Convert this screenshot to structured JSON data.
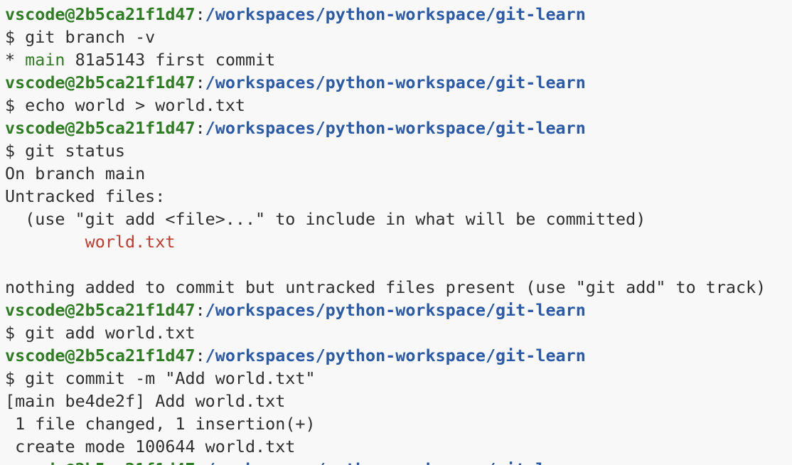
{
  "colors": {
    "background": "#f8f8f8",
    "text": "#2f2f2f",
    "prompt_user": "#2f7d22",
    "prompt_path": "#2a5aa8",
    "branch_highlight": "#2f7d22",
    "untracked_file": "#c23a2e"
  },
  "terminal": {
    "prompt": {
      "user_host": "vscode@2b5ca21f1d47",
      "separator": ":",
      "path": "/workspaces/python-workspace/git-learn"
    },
    "lines": [
      {
        "kind": "prompt"
      },
      {
        "kind": "command",
        "text": "$ git branch -v"
      },
      {
        "kind": "branch",
        "marker": "* ",
        "branch": "main",
        "rest": " 81a5143 first commit"
      },
      {
        "kind": "prompt"
      },
      {
        "kind": "command",
        "text": "$ echo world > world.txt"
      },
      {
        "kind": "prompt"
      },
      {
        "kind": "command",
        "text": "$ git status"
      },
      {
        "kind": "output",
        "text": "On branch main"
      },
      {
        "kind": "output",
        "text": "Untracked files:"
      },
      {
        "kind": "output",
        "text": "  (use \"git add <file>...\" to include in what will be committed)"
      },
      {
        "kind": "untracked",
        "indent": "        ",
        "text": "world.txt"
      },
      {
        "kind": "blank"
      },
      {
        "kind": "output",
        "text": "nothing added to commit but untracked files present (use \"git add\" to track)"
      },
      {
        "kind": "prompt"
      },
      {
        "kind": "command",
        "text": "$ git add world.txt"
      },
      {
        "kind": "prompt"
      },
      {
        "kind": "command",
        "text": "$ git commit -m \"Add world.txt\""
      },
      {
        "kind": "output",
        "text": "[main be4de2f] Add world.txt"
      },
      {
        "kind": "output",
        "text": " 1 file changed, 1 insertion(+)"
      },
      {
        "kind": "output",
        "text": " create mode 100644 world.txt"
      },
      {
        "kind": "prompt"
      }
    ]
  }
}
